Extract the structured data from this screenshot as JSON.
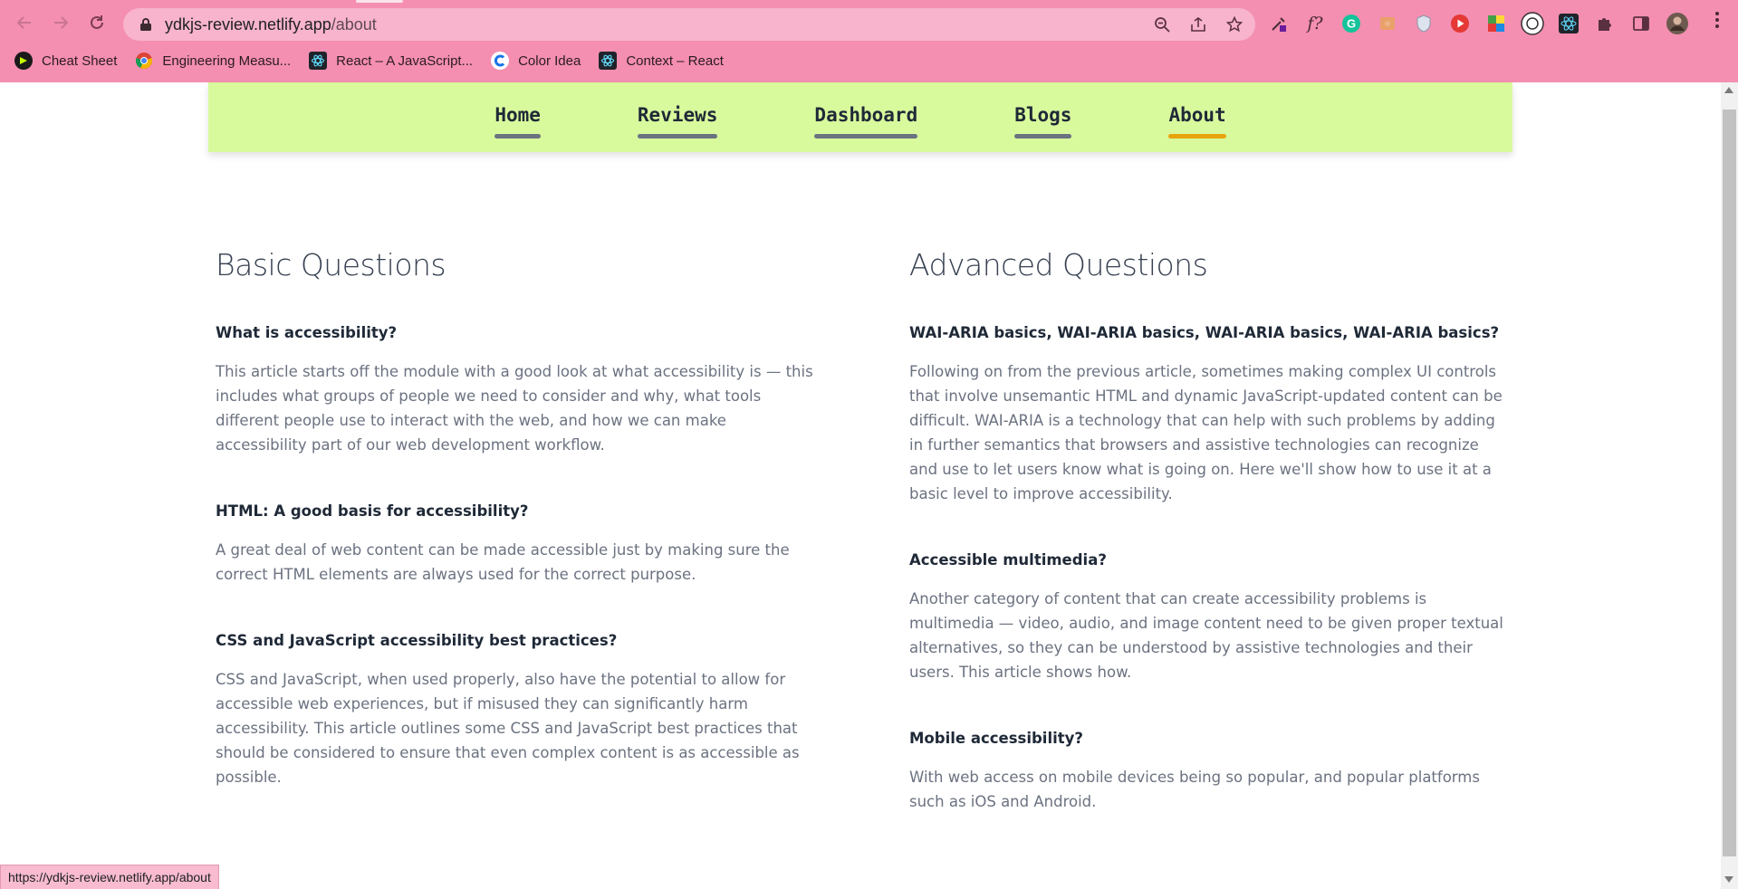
{
  "browser": {
    "url_host": "ydkjs-review.netlify.app",
    "url_path": "/about",
    "status_url": "https://ydkjs-review.netlify.app/about",
    "chrome_color": "#f48fb1",
    "bookmarks": [
      {
        "label": "Cheat Sheet",
        "icon": "cheat-sheet-favicon",
        "color": "#1a1a1a"
      },
      {
        "label": "Engineering Measu...",
        "icon": "chrome-favicon",
        "color": "#4285f4"
      },
      {
        "label": "React – A JavaScript...",
        "icon": "react-favicon",
        "color": "#20232a"
      },
      {
        "label": "Color Idea",
        "icon": "color-idea-favicon",
        "color": "#1a73e8"
      },
      {
        "label": "Context – React",
        "icon": "react-favicon",
        "color": "#20232a"
      }
    ],
    "extensions": [
      "eyedropper-icon",
      "formula-icon",
      "grammarly-icon",
      "picture-icon",
      "shield-icon",
      "youtube-icon",
      "color-grid-icon",
      "circle-icon",
      "react-devtools-icon",
      "puzzle-icon",
      "sidebar-icon",
      "profile-avatar"
    ]
  },
  "nav": {
    "bg_color": "#d9f99d",
    "active_color": "#e8a30e",
    "items": [
      {
        "label": "Home",
        "active": false
      },
      {
        "label": "Reviews",
        "active": false
      },
      {
        "label": "Dashboard",
        "active": false
      },
      {
        "label": "Blogs",
        "active": false
      },
      {
        "label": "About",
        "active": true
      }
    ]
  },
  "basic": {
    "title": "Basic Questions",
    "items": [
      {
        "question": "What is accessibility?",
        "answer": "This article starts off the module with a good look at what accessibility is — this includes what groups of people we need to consider and why, what tools different people use to interact with the web, and how we can make accessibility part of our web development workflow."
      },
      {
        "question": "HTML: A good basis for accessibility?",
        "answer": "A great deal of web content can be made accessible just by making sure the correct HTML elements are always used for the correct purpose."
      },
      {
        "question": "CSS and JavaScript accessibility best practices?",
        "answer": "CSS and JavaScript, when used properly, also have the potential to allow for accessible web experiences, but if misused they can significantly harm accessibility. This article outlines some CSS and JavaScript best practices that should be considered to ensure that even complex content is as accessible as possible."
      }
    ]
  },
  "advanced": {
    "title": "Advanced Questions",
    "items": [
      {
        "question": "WAI-ARIA basics, WAI-ARIA basics, WAI-ARIA basics, WAI-ARIA basics?",
        "answer": "Following on from the previous article, sometimes making complex UI controls that involve unsemantic HTML and dynamic JavaScript-updated content can be difficult. WAI-ARIA is a technology that can help with such problems by adding in further semantics that browsers and assistive technologies can recognize and use to let users know what is going on. Here we'll show how to use it at a basic level to improve accessibility."
      },
      {
        "question": "Accessible multimedia?",
        "answer": "Another category of content that can create accessibility problems is multimedia — video, audio, and image content need to be given proper textual alternatives, so they can be understood by assistive technologies and their users. This article shows how."
      },
      {
        "question": "Mobile accessibility?",
        "answer": "With web access on mobile devices being so popular, and popular platforms such as iOS and Android."
      }
    ]
  }
}
